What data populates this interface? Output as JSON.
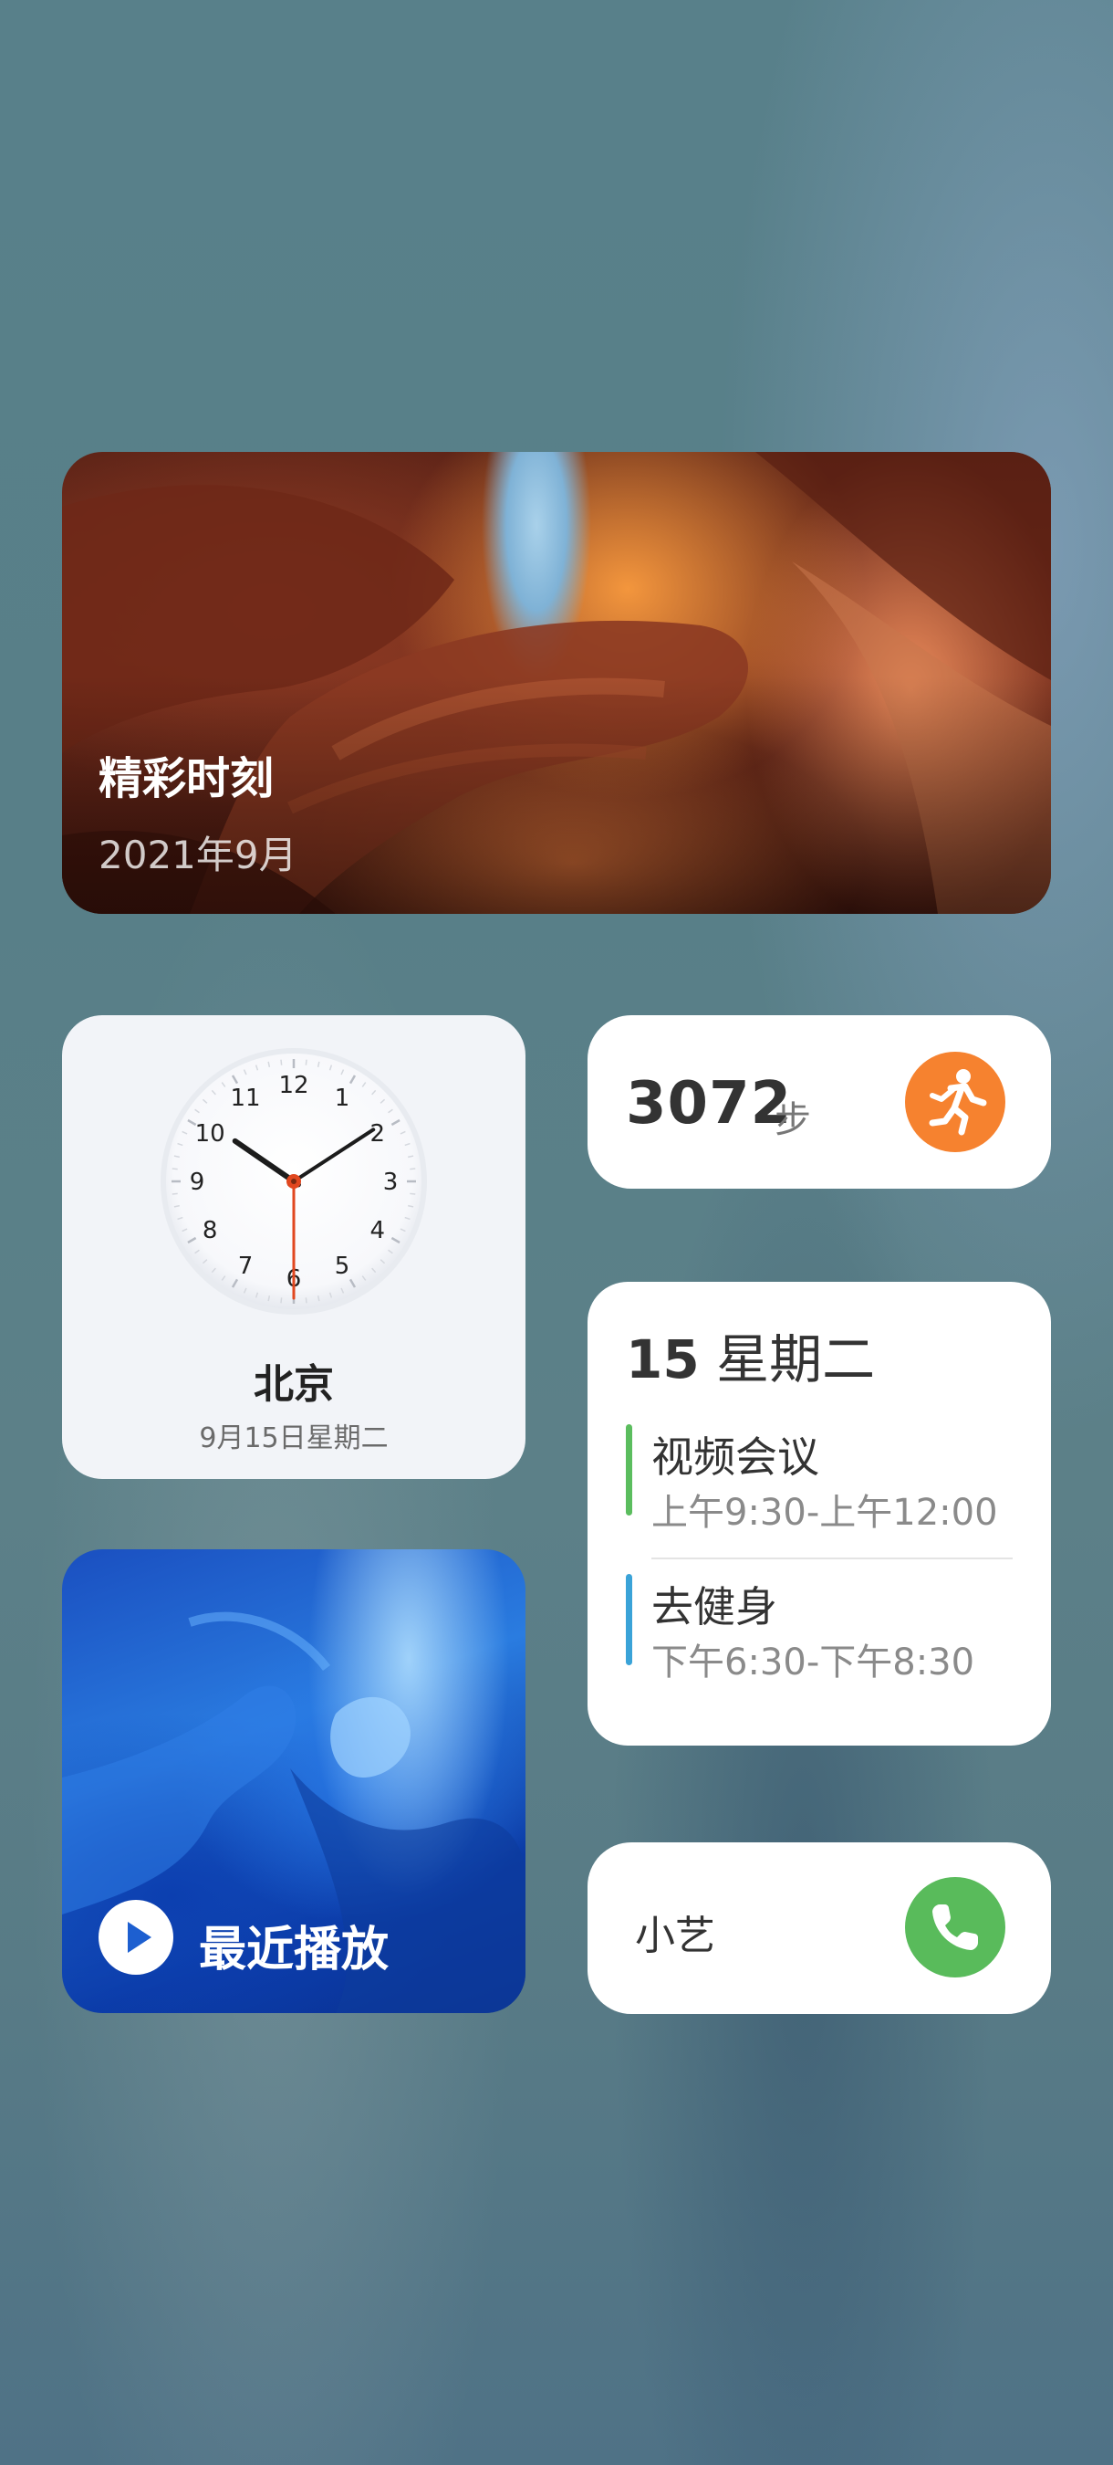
{
  "photo_widget": {
    "title": "精彩时刻",
    "subtitle": "2021年9月"
  },
  "clock_widget": {
    "city": "北京",
    "date": "9月15日星期二",
    "numerals": [
      "12",
      "1",
      "2",
      "3",
      "4",
      "5",
      "6",
      "7",
      "8",
      "9",
      "10",
      "11"
    ],
    "time": {
      "hour": 10,
      "minute": 9,
      "second": 30
    }
  },
  "steps_widget": {
    "value": "3072",
    "unit": "步",
    "icon": "running-person-icon",
    "accent": "#f6822f"
  },
  "calendar_widget": {
    "day": "15",
    "weekday": "星期二",
    "events": [
      {
        "title": "视频会议",
        "time": "上午9:30-上午12:00",
        "color": "#5bbd5e"
      },
      {
        "title": "去健身",
        "time": "下午6:30-下午8:30",
        "color": "#3aa3d8"
      }
    ]
  },
  "music_widget": {
    "label": "最近播放",
    "icon": "play-icon"
  },
  "assistant_widget": {
    "label": "小艺",
    "icon": "phone-icon",
    "accent": "#59bb5b"
  }
}
